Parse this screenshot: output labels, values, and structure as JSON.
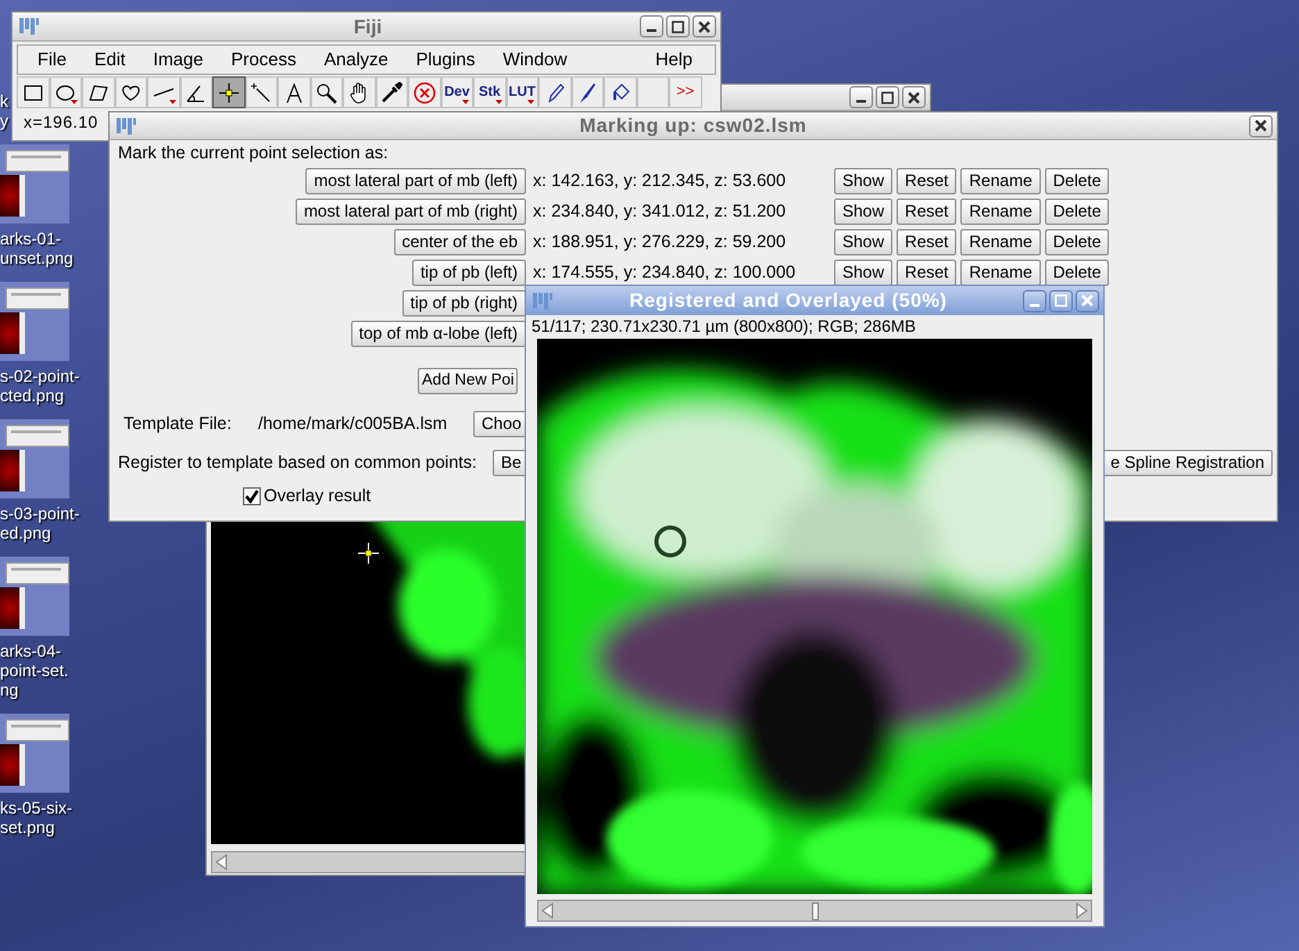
{
  "desktop": {
    "icons": [
      {
        "kind": "label_only",
        "label_lines": [
          "k",
          "y"
        ]
      },
      {
        "kind": "thumbnail",
        "label_lines": [
          "arks-01-",
          "unset.png"
        ]
      },
      {
        "kind": "thumbnail",
        "label_lines": [
          "s-02-point-",
          "cted.png"
        ]
      },
      {
        "kind": "thumbnail",
        "label_lines": [
          "s-03-point-",
          "ed.png"
        ]
      },
      {
        "kind": "thumbnail",
        "label_lines": [
          "arks-04-",
          "point-set.",
          "ng"
        ]
      },
      {
        "kind": "thumbnail",
        "label_lines": [
          "ks-05-six-",
          "set.png"
        ]
      }
    ]
  },
  "fiji_window": {
    "title": "Fiji",
    "menu": [
      "File",
      "Edit",
      "Image",
      "Process",
      "Analyze",
      "Plugins",
      "Window",
      "Help"
    ],
    "tools": [
      {
        "kind": "rectangle",
        "selected": false,
        "menu": false
      },
      {
        "kind": "oval",
        "selected": false,
        "menu": true
      },
      {
        "kind": "polygon",
        "selected": false,
        "menu": false
      },
      {
        "kind": "freehand",
        "selected": false,
        "menu": false
      },
      {
        "kind": "line",
        "selected": false,
        "menu": true
      },
      {
        "kind": "angle",
        "selected": false,
        "menu": false
      },
      {
        "kind": "point",
        "selected": true,
        "menu": false
      },
      {
        "kind": "wand",
        "selected": false,
        "menu": false
      },
      {
        "kind": "text",
        "selected": false,
        "menu": false
      },
      {
        "kind": "magnifier",
        "selected": false,
        "menu": false
      },
      {
        "kind": "hand",
        "selected": false,
        "menu": false
      },
      {
        "kind": "dropper",
        "selected": false,
        "menu": false
      },
      {
        "kind": "stop",
        "selected": false,
        "menu": false
      },
      {
        "kind": "label",
        "label": "Dev",
        "selected": false,
        "menu": true
      },
      {
        "kind": "label",
        "label": "Stk",
        "selected": false,
        "menu": true
      },
      {
        "kind": "label",
        "label": "LUT",
        "selected": false,
        "menu": true
      },
      {
        "kind": "pencil",
        "selected": false,
        "menu": false
      },
      {
        "kind": "brush",
        "selected": false,
        "menu": false
      },
      {
        "kind": "flood",
        "selected": false,
        "menu": false
      },
      {
        "kind": "blank",
        "selected": false,
        "menu": false
      },
      {
        "kind": "more",
        "label": ">>",
        "selected": false,
        "menu": false
      }
    ],
    "status": "x=196.10"
  },
  "marking_window": {
    "title": "Marking up: csw02.lsm",
    "prompt": "Mark the current point selection as:",
    "points": [
      {
        "name": "most lateral part of mb (left)",
        "coords": "x: 142.163, y: 212.345, z: 53.600",
        "actions": [
          "Show",
          "Reset",
          "Rename",
          "Delete"
        ]
      },
      {
        "name": "most lateral part of mb (right)",
        "coords": "x: 234.840, y: 341.012, z: 51.200",
        "actions": [
          "Show",
          "Reset",
          "Rename",
          "Delete"
        ]
      },
      {
        "name": "center of the eb",
        "coords": "x: 188.951, y: 276.229, z: 59.200",
        "actions": [
          "Show",
          "Reset",
          "Rename",
          "Delete"
        ]
      },
      {
        "name": "tip of pb (left)",
        "coords": "x: 174.555, y: 234.840, z: 100.000",
        "actions": [
          "Show",
          "Reset",
          "Rename",
          "Delete"
        ]
      },
      {
        "name": "tip of pb (right)"
      },
      {
        "name": "top of mb α-lobe (left)"
      }
    ],
    "add_button": "Add New Poi",
    "template_label": "Template File:",
    "template_path": "/home/mark/c005BA.lsm",
    "choose_button": "Choo",
    "register_label": "Register to template based on common points:",
    "register_buttons": [
      "Be",
      "e Spline Registration"
    ],
    "overlay": {
      "label": "Overlay result",
      "checked": true
    }
  },
  "overlay_window": {
    "title": "Registered and Overlayed (50%)",
    "info": "51/117; 230.71x230.71 µm (800x800); RGB; 286MB"
  }
}
